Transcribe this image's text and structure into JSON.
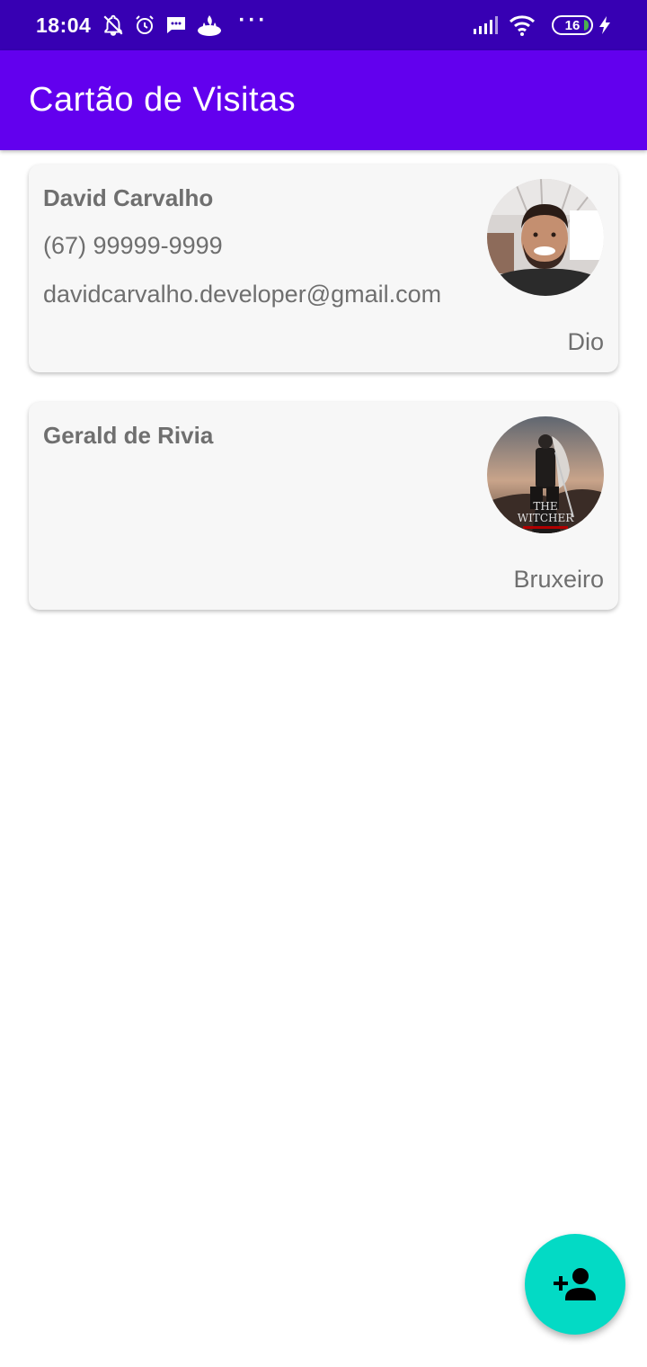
{
  "status_bar": {
    "time": "18:04",
    "icons": [
      "notifications-off-icon",
      "alarm-icon",
      "message-icon",
      "santander-icon",
      "more-icon"
    ],
    "more": "···",
    "battery_level": "16",
    "right_icons": [
      "signal-icon",
      "wifi-icon",
      "battery-icon",
      "charging-icon"
    ]
  },
  "app_bar": {
    "title": "Cartão de Visitas",
    "background": "#6200ee"
  },
  "cards": [
    {
      "name": "David Carvalho",
      "phone": "(67) 99999-9999",
      "email": "davidcarvalho.developer@gmail.com",
      "company": "Dio",
      "avatar": "person-photo"
    },
    {
      "name": "Gerald de Rivia",
      "phone": "",
      "email": "",
      "company": "Bruxeiro",
      "avatar": "the-witcher-poster"
    }
  ],
  "fab": {
    "icon": "add-person-icon",
    "color": "#03dac5"
  }
}
